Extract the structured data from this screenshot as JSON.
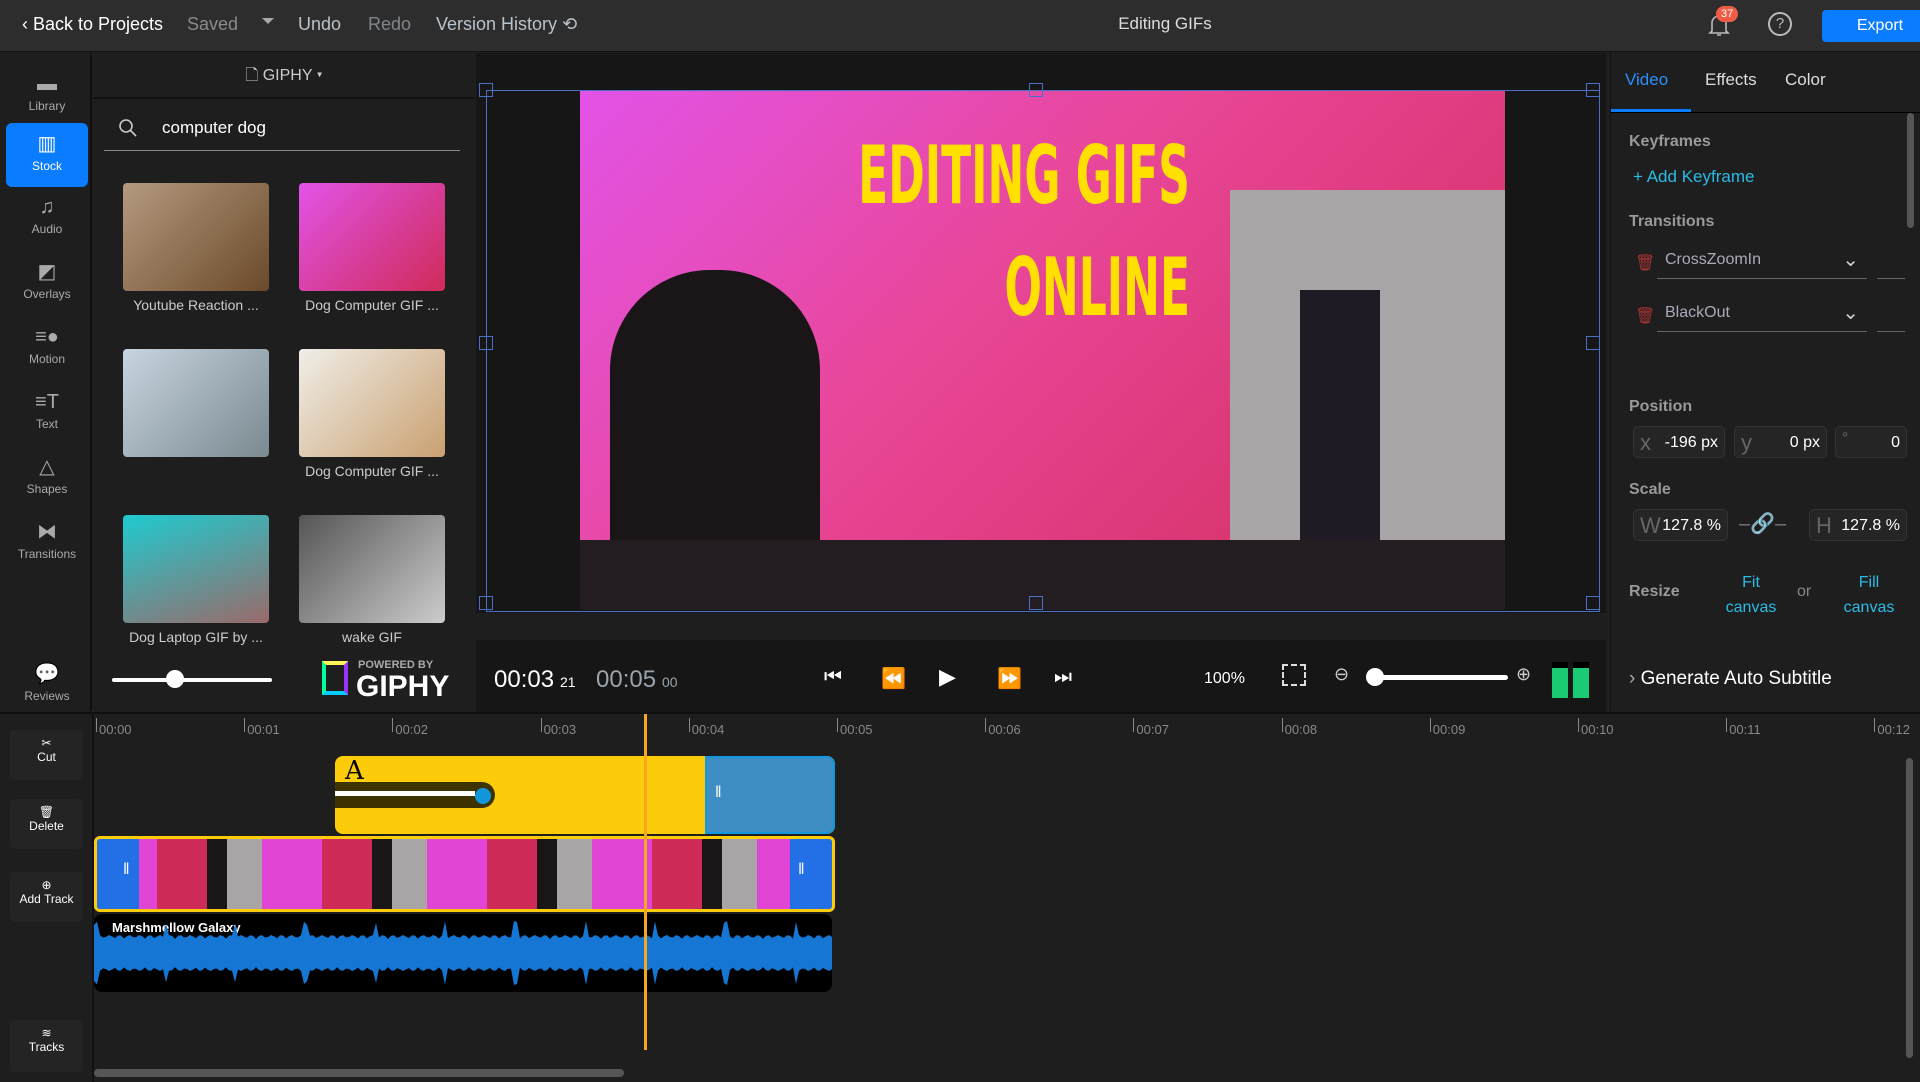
{
  "topbar": {
    "back": "Back to Projects",
    "saved": "Saved",
    "undo": "Undo",
    "redo": "Redo",
    "version_history": "Version History",
    "title": "Editing GIFs",
    "notifications": "37",
    "export": "Export"
  },
  "nav": [
    {
      "label": "Library",
      "icon": "folder-icon"
    },
    {
      "label": "Stock",
      "icon": "books-icon",
      "active": true
    },
    {
      "label": "Audio",
      "icon": "music-icon"
    },
    {
      "label": "Overlays",
      "icon": "overlay-icon"
    },
    {
      "label": "Motion",
      "icon": "motion-icon"
    },
    {
      "label": "Text",
      "icon": "text-icon"
    },
    {
      "label": "Shapes",
      "icon": "shapes-icon"
    },
    {
      "label": "Transitions",
      "icon": "transitions-icon"
    },
    {
      "label": "Reviews",
      "icon": "chat-icon"
    }
  ],
  "stock": {
    "source": "GIPHY",
    "search": "computer dog",
    "items": [
      "Youtube Reaction ...",
      "Dog Computer GIF ...",
      "",
      "Dog Computer GIF ...",
      "Dog Laptop GIF by ...",
      "wake GIF"
    ],
    "powered_by": "POWERED BY",
    "giphy": "GIPHY",
    "thumb_size": 0.45
  },
  "preview": {
    "overlay_line1": "EDITING GIFS",
    "overlay_line2": "ONLINE"
  },
  "transport": {
    "current": "00:03",
    "current_frames": "21",
    "total": "00:05",
    "total_frames": "00",
    "zoom": "100%",
    "timeline_zoom": 0.0
  },
  "panel": {
    "tabs": [
      "Video",
      "Effects",
      "Color"
    ],
    "keyframes": "Keyframes",
    "add_keyframe": "Add Keyframe",
    "transitions": "Transitions",
    "transition_items": [
      "CrossZoomIn",
      "BlackOut"
    ],
    "position": "Position",
    "x": "-196 px",
    "y": "0 px",
    "rot": "0",
    "scale": "Scale",
    "w": "127.8 %",
    "h": "127.8 %",
    "resize": "Resize",
    "fit": "Fit canvas",
    "or": "or",
    "fill": "Fill canvas",
    "subtitle": "Generate Auto Subtitle"
  },
  "timeline": {
    "tools": [
      "Cut",
      "Delete",
      "Add Track",
      "Tracks"
    ],
    "ticks": [
      "00:00",
      "00:01",
      "00:02",
      "00:03",
      "00:04",
      "00:05",
      "00:06",
      "00:07",
      "00:08",
      "00:09",
      "00:10",
      "00:11",
      "00:12"
    ],
    "audio_label": "Marshmellow Galaxy",
    "text_clip_label": "A",
    "playhead_time": 3.7
  }
}
